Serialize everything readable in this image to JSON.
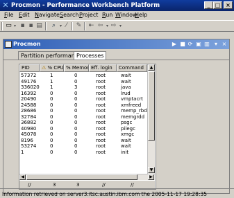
{
  "window": {
    "title": "Procmon - Performance Workbench Platform",
    "controls": [
      "_",
      "□",
      "×"
    ]
  },
  "menu": [
    "File",
    "Edit",
    "Navigate",
    "Search",
    "Project",
    "Run",
    "Window",
    "Help"
  ],
  "view": {
    "title": "Procmon",
    "tabs": [
      {
        "label": "Partition performance",
        "selected": false
      },
      {
        "label": "Processes",
        "selected": true
      }
    ]
  },
  "table": {
    "columns": [
      "PID",
      "% CPU",
      "% Memory",
      "Eff. login",
      "Command"
    ],
    "rows": [
      [
        "57372",
        "1",
        "0",
        "root",
        "wait"
      ],
      [
        "49176",
        "1",
        "0",
        "root",
        "wait"
      ],
      [
        "336020",
        "1",
        "3",
        "root",
        "java"
      ],
      [
        "16392",
        "0",
        "0",
        "root",
        "lrud"
      ],
      [
        "20490",
        "0",
        "0",
        "root",
        "vmptacrt"
      ],
      [
        "24588",
        "0",
        "0",
        "root",
        "xmfreed"
      ],
      [
        "28686",
        "0",
        "0",
        "root",
        "memp_rbd"
      ],
      [
        "32784",
        "0",
        "0",
        "root",
        "memgrdd"
      ],
      [
        "36882",
        "0",
        "0",
        "root",
        "psgc"
      ],
      [
        "40980",
        "0",
        "0",
        "root",
        "pilegc"
      ],
      [
        "45078",
        "0",
        "0",
        "root",
        "xmgc"
      ],
      [
        "8196",
        "0",
        "0",
        "root",
        "wait"
      ],
      [
        "53274",
        "0",
        "0",
        "root",
        "wait"
      ],
      [
        "1",
        "0",
        "0",
        "root",
        "init"
      ]
    ],
    "totals": [
      "//",
      "3",
      "3",
      "//",
      "//"
    ]
  },
  "status": "Information retrieved on server3.itsc.austin.ibm.com the 2005-11-17 19:28:35"
}
